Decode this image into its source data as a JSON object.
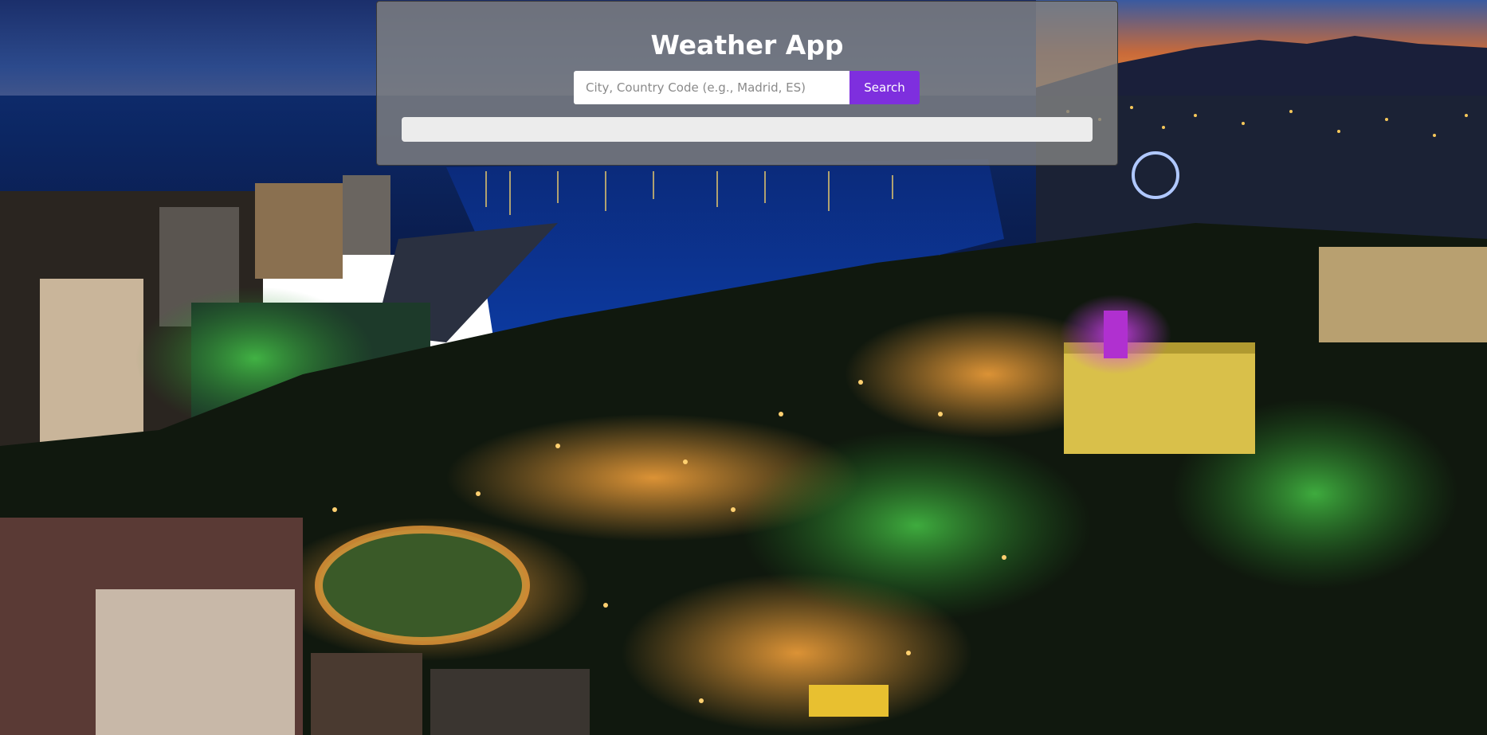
{
  "app": {
    "title": "Weather App"
  },
  "search": {
    "placeholder": "City, Country Code (e.g., Madrid, ES)",
    "value": "",
    "button_label": "Search"
  },
  "result": {
    "text": ""
  },
  "colors": {
    "accent": "#7e2fde",
    "panel": "#808080",
    "result_bar": "#ececec"
  },
  "background": {
    "description_icon": "night-city-harbor-photo"
  }
}
